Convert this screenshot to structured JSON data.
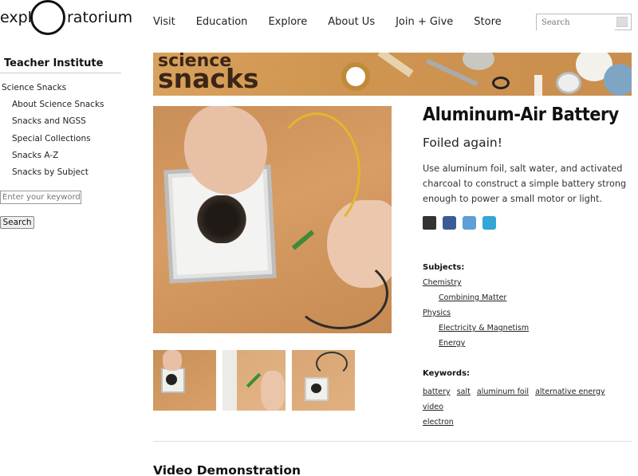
{
  "header": {
    "logo_left": "expl",
    "logo_right": "ratorium",
    "nav": [
      "Visit",
      "Education",
      "Explore",
      "About Us",
      "Join + Give",
      "Store"
    ],
    "search_placeholder": "Search"
  },
  "sidebar": {
    "title": "Teacher Institute",
    "items": [
      {
        "label": "Science Snacks",
        "sub": false
      },
      {
        "label": "About Science Snacks",
        "sub": true
      },
      {
        "label": "Snacks and NGSS",
        "sub": true
      },
      {
        "label": "Special Collections",
        "sub": true
      },
      {
        "label": "Snacks A-Z",
        "sub": true
      },
      {
        "label": "Snacks by Subject",
        "sub": true
      }
    ],
    "keyword_placeholder": "Enter your keywords",
    "search_button": "Search"
  },
  "banner": {
    "line1": "science",
    "line2": "snacks"
  },
  "article": {
    "title": "Aluminum-Air Battery",
    "subtitle": "Foiled again!",
    "description": "Use aluminum foil, salt water, and activated charcoal to construct a simple battery strong enough to power a small motor or light.",
    "share_icons": [
      "print-icon",
      "facebook-icon",
      "delicious-icon",
      "twitter-icon"
    ],
    "subjects_label": "Subjects:",
    "subjects": [
      {
        "label": "Chemistry",
        "level": 0
      },
      {
        "label": "Combining Matter",
        "level": 1
      },
      {
        "label": "Physics",
        "level": 0
      },
      {
        "label": "Electricity & Magnetism",
        "level": 1
      },
      {
        "label": "Energy",
        "level": 1
      }
    ],
    "keywords_label": "Keywords:",
    "keywords": [
      "battery",
      "salt",
      "aluminum foil",
      "alternative energy",
      "video",
      "electron"
    ]
  },
  "video": {
    "title": "Video Demonstration"
  },
  "colors": {
    "banner": "#cf9550",
    "link": "#222222",
    "facebook": "#3b5b98",
    "twitter": "#32a6d7"
  }
}
